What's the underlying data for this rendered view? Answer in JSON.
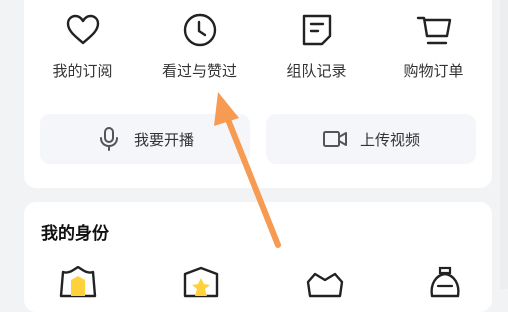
{
  "quick_menu": [
    {
      "label": "我的订阅",
      "icon": "heart-icon"
    },
    {
      "label": "看过与赞过",
      "icon": "clock-icon"
    },
    {
      "label": "组队记录",
      "icon": "note-icon"
    },
    {
      "label": "购物订单",
      "icon": "shopping-cart-icon"
    }
  ],
  "actions": {
    "live": {
      "label": "我要开播",
      "icon": "microphone-icon"
    },
    "upload": {
      "label": "上传视频",
      "icon": "video-camera-icon"
    }
  },
  "identity_section": {
    "title": "我的身份",
    "badges": [
      "shield-badge-icon",
      "shield-star-badge-icon",
      "crown-badge-icon",
      "medal-badge-icon"
    ]
  },
  "colors": {
    "accent_yellow": "#ffd23c",
    "annotation_arrow": "#f79a52"
  }
}
